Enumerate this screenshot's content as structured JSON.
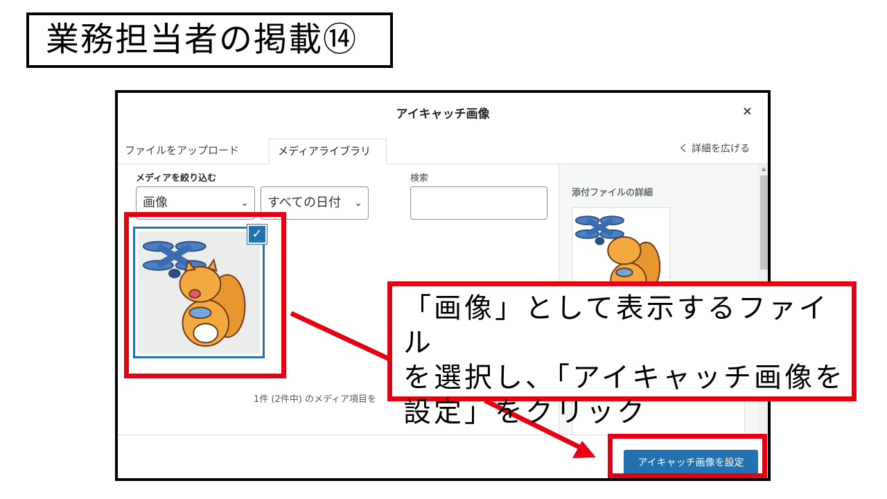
{
  "slide": {
    "title": "業務担当者の掲載⑭"
  },
  "modal": {
    "title": "アイキャッチ画像",
    "close_symbol": "×",
    "tabs": [
      {
        "label": "ファイルをアップロード",
        "active": false
      },
      {
        "label": "メディアライブラリ",
        "active": true
      }
    ],
    "expand_details": "く 詳細を広げる",
    "filter_label": "メディアを絞り込む",
    "type_filter": {
      "selected": "画像"
    },
    "date_filter": {
      "selected": "すべての日付"
    },
    "search_label": "検索",
    "search_value": "",
    "count_text": "1件 (2件中) のメディア項目を",
    "attachment": {
      "selected": true,
      "check_icon": "✓"
    },
    "sidebar": {
      "heading": "添付ファイルの詳細"
    },
    "set_button": "アイキャッチ画像を設定"
  },
  "callout": {
    "lines": [
      "「画像」として表示するファイル",
      "を選択し、「アイキャッチ画像を",
      "設定」をクリック"
    ]
  },
  "colors": {
    "highlight": "#e60012",
    "primary_button": "#2271b1",
    "sidebar_bg": "#f6f7f7"
  }
}
